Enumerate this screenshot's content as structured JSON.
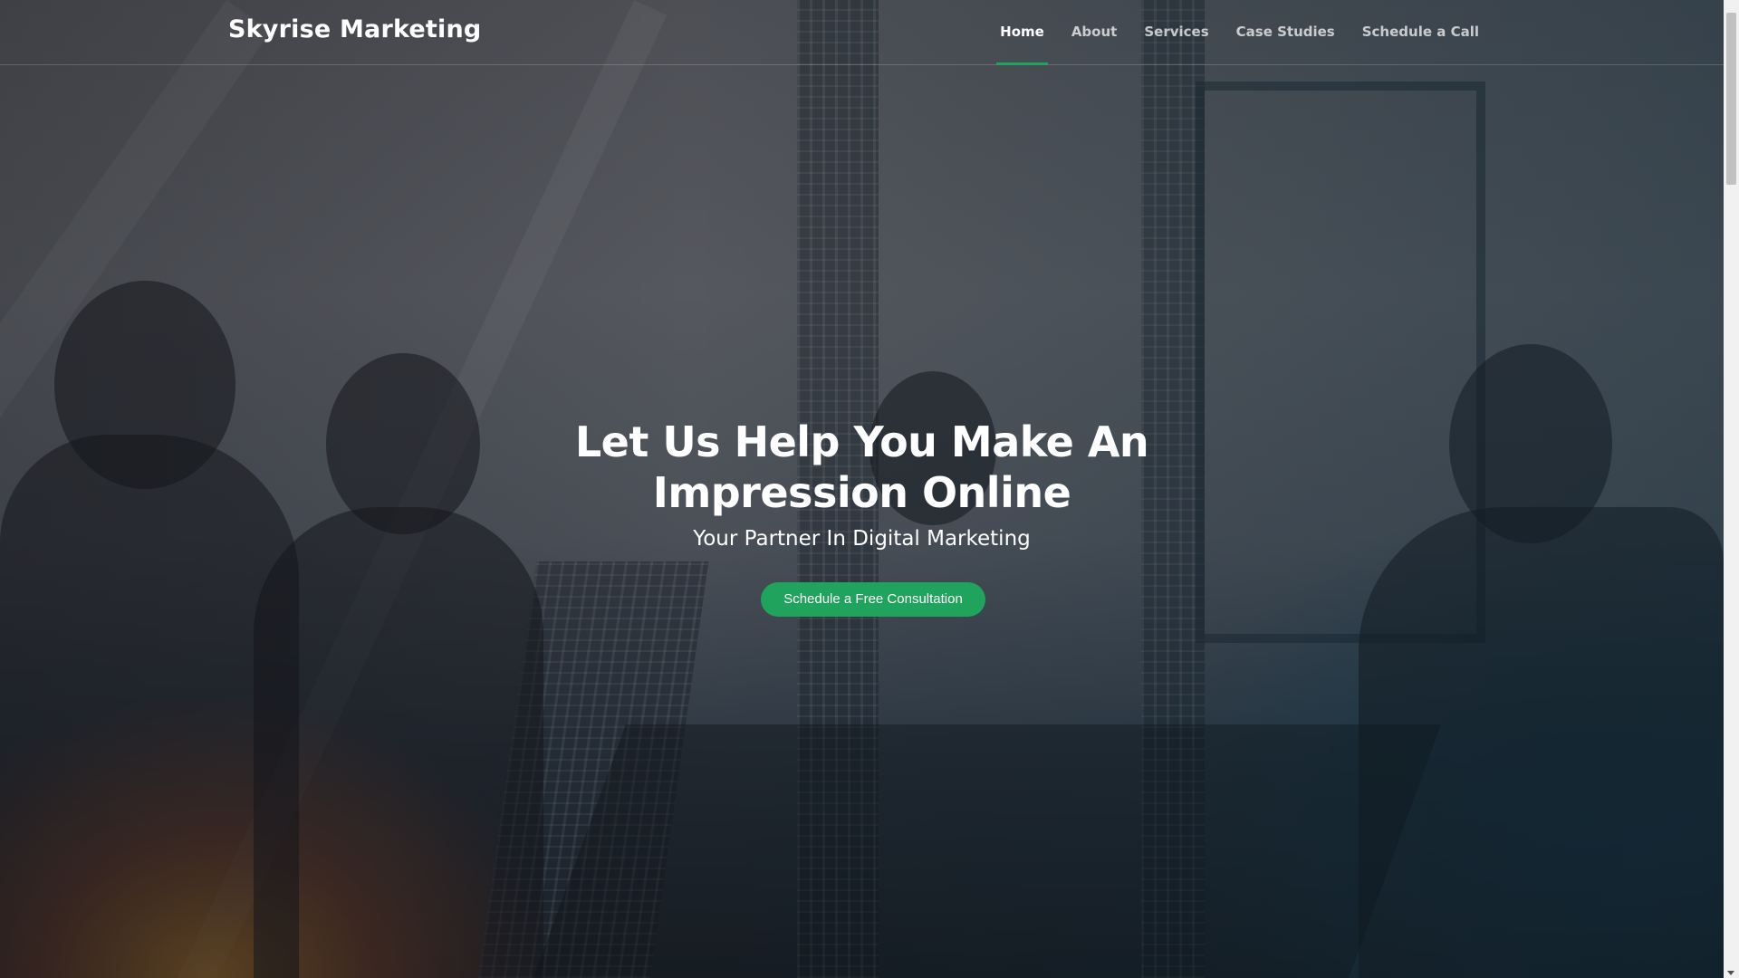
{
  "header": {
    "brand": "Skyrise Marketing",
    "nav": [
      {
        "label": "Home",
        "active": true
      },
      {
        "label": "About",
        "active": false
      },
      {
        "label": "Services",
        "active": false
      },
      {
        "label": "Case Studies",
        "active": false
      },
      {
        "label": "Schedule a Call",
        "active": false
      }
    ]
  },
  "hero": {
    "headline": "Let Us Help You Make An Impression Online",
    "subheadline": "Your Partner In Digital Marketing",
    "cta_label": "Schedule a Free Consultation",
    "background": "office-team-silhouette-photo"
  },
  "colors": {
    "accent": "#1fa35d",
    "header_text": "#ffffff",
    "nav_inactive": "#c7c8ca"
  },
  "scrollbar": {
    "icon": "chevron-down-icon"
  }
}
